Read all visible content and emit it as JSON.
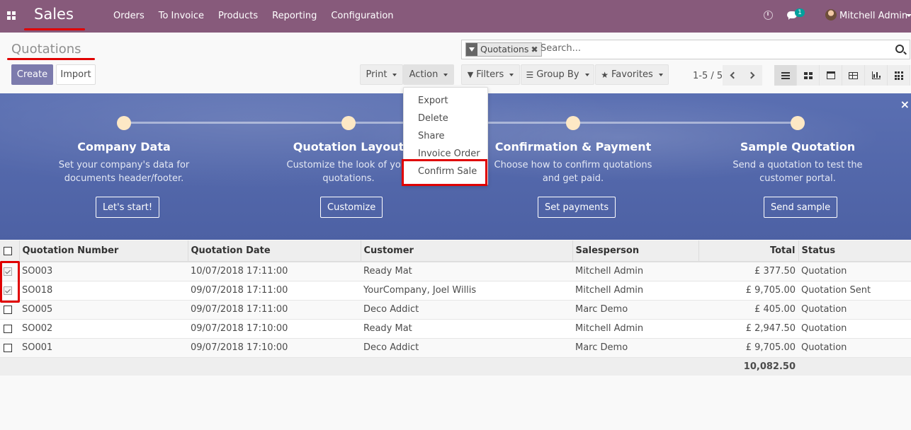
{
  "topnav": {
    "brand": "Sales",
    "menu": [
      "Orders",
      "To Invoice",
      "Products",
      "Reporting",
      "Configuration"
    ],
    "chat_badge": "1",
    "user_name": "Mitchell Admin"
  },
  "control": {
    "breadcrumb": "Quotations",
    "create_label": "Create",
    "import_label": "Import",
    "print_label": "Print",
    "action_label": "Action",
    "filters_label": "Filters",
    "groupby_label": "Group By",
    "favorites_label": "Favorites",
    "pager": "1-5 / 5",
    "search": {
      "facet": "Quotations",
      "placeholder": "Search..."
    }
  },
  "action_menu": {
    "items": [
      "Export",
      "Delete",
      "Share",
      "Invoice Order",
      "Confirm Sale"
    ]
  },
  "banner": {
    "steps": [
      {
        "title": "Company Data",
        "desc1": "Set your company's data for",
        "desc2": "documents header/footer.",
        "button": "Let's start!"
      },
      {
        "title": "Quotation Layout",
        "desc1": "Customize the look of your",
        "desc2": "quotations.",
        "button": "Customize"
      },
      {
        "title": "Confirmation & Payment",
        "desc1": "Choose how to confirm quotations",
        "desc2": "and get paid.",
        "button": "Set payments"
      },
      {
        "title": "Sample Quotation",
        "desc1": "Send a quotation to test the",
        "desc2": "customer portal.",
        "button": "Send sample"
      }
    ],
    "close": "×"
  },
  "table": {
    "columns": [
      "Quotation Number",
      "Quotation Date",
      "Customer",
      "Salesperson",
      "Total",
      "Status"
    ],
    "rows": [
      {
        "number": "SO003",
        "date": "10/07/2018 17:11:00",
        "customer": "Ready Mat",
        "salesperson": "Mitchell Admin",
        "total": "£ 377.50",
        "status": "Quotation"
      },
      {
        "number": "SO018",
        "date": "09/07/2018 17:11:00",
        "customer": "YourCompany, Joel Willis",
        "salesperson": "Mitchell Admin",
        "total": "£ 9,705.00",
        "status": "Quotation Sent"
      },
      {
        "number": "SO005",
        "date": "09/07/2018 17:11:00",
        "customer": "Deco Addict",
        "salesperson": "Marc Demo",
        "total": "£ 405.00",
        "status": "Quotation"
      },
      {
        "number": "SO002",
        "date": "09/07/2018 17:10:00",
        "customer": "Ready Mat",
        "salesperson": "Mitchell Admin",
        "total": "£ 2,947.50",
        "status": "Quotation"
      },
      {
        "number": "SO001",
        "date": "09/07/2018 17:10:00",
        "customer": "Deco Addict",
        "salesperson": "Marc Demo",
        "total": "£ 9,705.00",
        "status": "Quotation"
      }
    ],
    "sum_total": "10,082.50"
  }
}
